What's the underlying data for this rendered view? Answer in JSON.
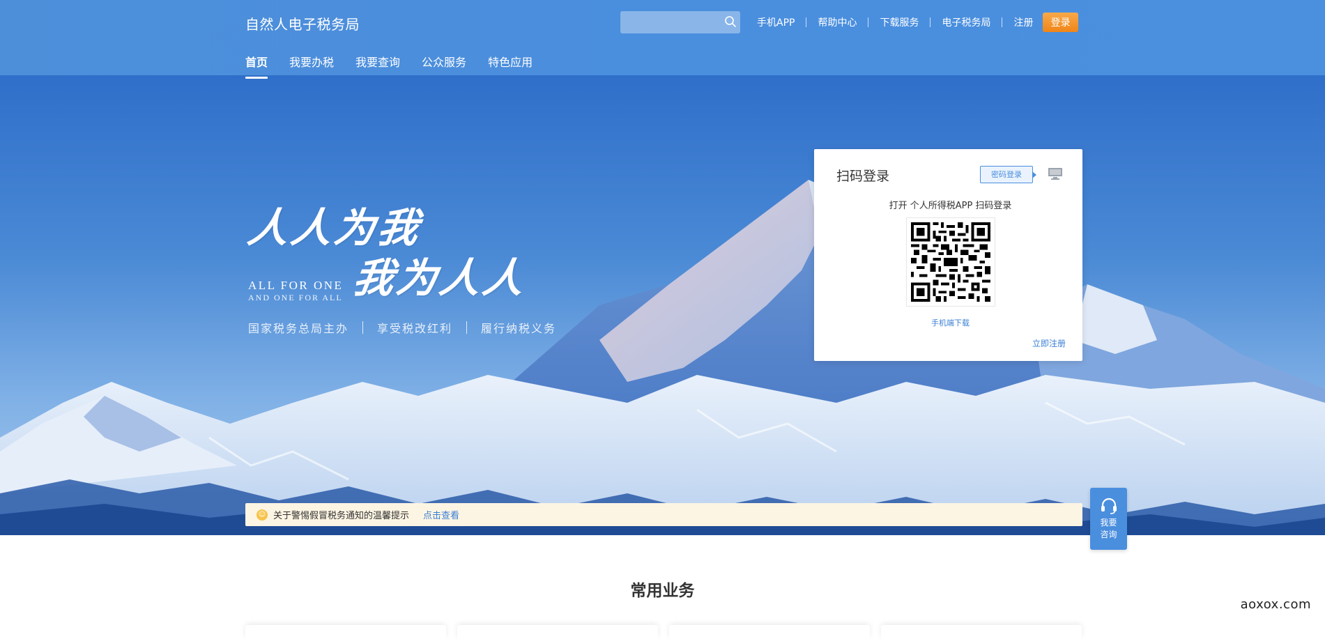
{
  "header": {
    "brand": "自然人电子税务局",
    "search": {
      "placeholder": "",
      "icon": "search-icon"
    },
    "links": [
      "手机APP",
      "帮助中心",
      "下载服务",
      "电子税务局",
      "注册"
    ],
    "login_label": "登录",
    "nav": [
      "首页",
      "我要办税",
      "我要查询",
      "公众服务",
      "特色应用"
    ],
    "active_nav": "首页"
  },
  "hero": {
    "slogan_line1": "人人为我",
    "slogan_line2": "我为人人",
    "slogan_en1": "ALL FOR ONE",
    "slogan_en2": "AND ONE FOR ALL",
    "sub": [
      "国家税务总局主办",
      "享受税改红利",
      "履行纳税义务"
    ]
  },
  "login_card": {
    "title": "扫码登录",
    "password_login_label": "密码登录",
    "pc_icon": "computer-icon",
    "hint": "打开 个人所得税APP 扫码登录",
    "mobile_download": "手机端下载",
    "register_now": "立即注册"
  },
  "notice": {
    "text": "关于警惕假冒税务通知的温馨提示",
    "link": "点击查看",
    "icon": "smile-icon"
  },
  "consult": {
    "label": "我要咨询",
    "icon": "headset-icon"
  },
  "section": {
    "title": "常用业务"
  },
  "watermark": "aoxox.com",
  "colors": {
    "primary": "#4a8ede",
    "login_button": "#f39a2f",
    "notice_bg": "#fdf5e3",
    "link": "#3a7fd5"
  }
}
